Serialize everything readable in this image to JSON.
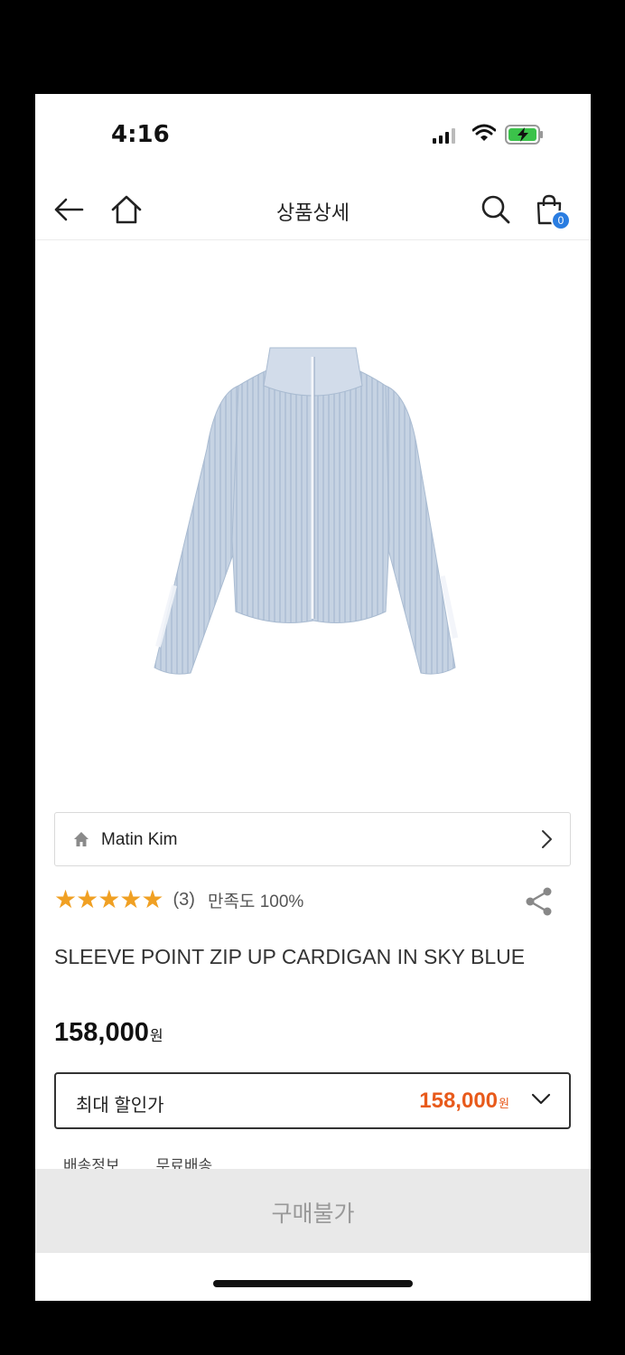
{
  "status_bar": {
    "time": "4:16"
  },
  "nav": {
    "title": "상품상세",
    "cart_count": "0"
  },
  "brand": {
    "name": "Matin Kim"
  },
  "rating": {
    "stars": "★★★★★",
    "review_count": "(3)",
    "satisfaction": "만족도 100%"
  },
  "product": {
    "title": "SLEEVE POINT ZIP UP CARDIGAN IN SKY BLUE",
    "price": "158,000",
    "currency": "원",
    "max_discount_label": "최대 할인가",
    "max_discount_price": "158,000",
    "max_discount_currency": "원"
  },
  "shipping": {
    "label": "배송정보",
    "value": "무료배송"
  },
  "buy_button": {
    "label": "구매불가"
  },
  "colors": {
    "accent_orange": "#e85a1b",
    "star_gold": "#f0a023",
    "badge_blue": "#2a7de1",
    "sky_blue": "#c9d6e6"
  }
}
